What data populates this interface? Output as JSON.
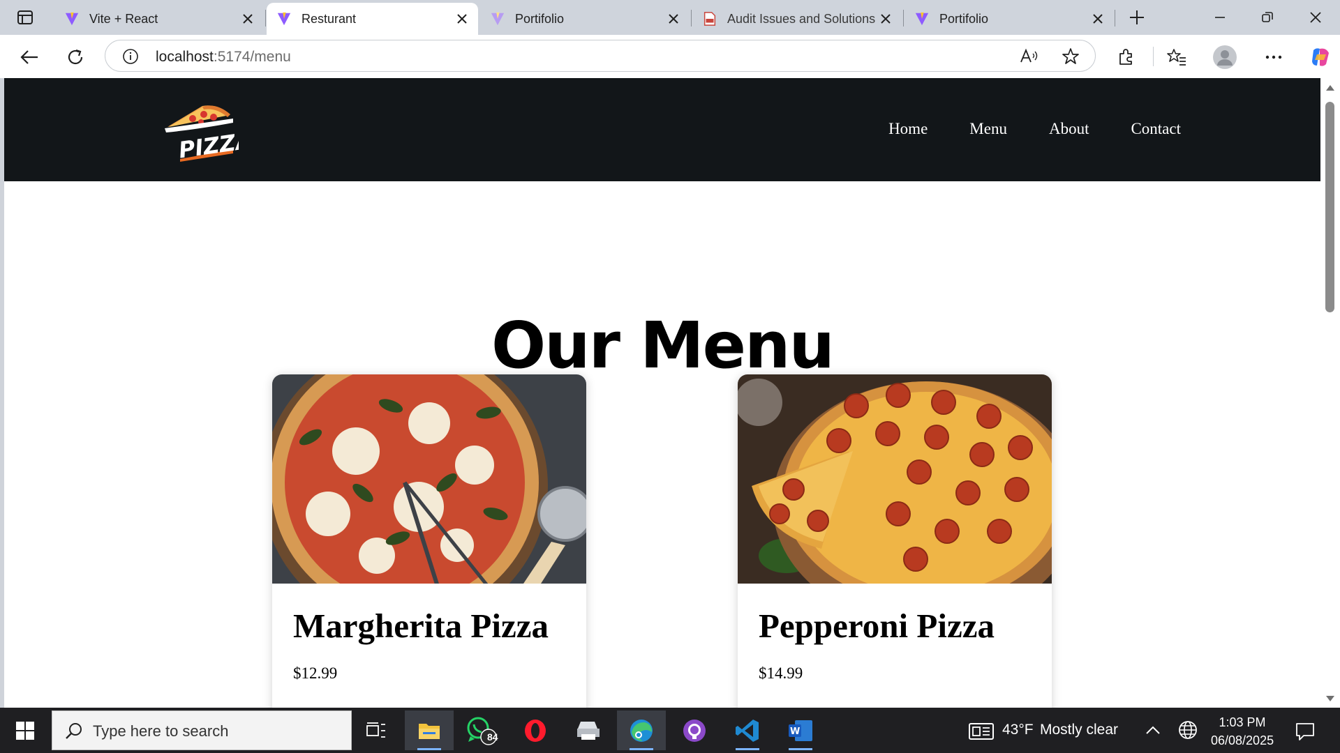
{
  "browser": {
    "tabs": [
      {
        "title": "Vite + React",
        "active": false
      },
      {
        "title": "Resturant",
        "active": true
      },
      {
        "title": "Portifolio",
        "active": false
      },
      {
        "title": "Audit Issues and Solutions",
        "active": false
      },
      {
        "title": "Portifolio",
        "active": false
      }
    ],
    "address": {
      "host": "localhost",
      "path": ":5174/menu"
    }
  },
  "site": {
    "logo_text": "PIZZA",
    "nav": [
      "Home",
      "Menu",
      "About",
      "Contact"
    ],
    "title": "Our Menu",
    "items": [
      {
        "name": "Margherita Pizza",
        "price": "$12.99"
      },
      {
        "name": "Pepperoni Pizza",
        "price": "$14.99"
      }
    ]
  },
  "taskbar": {
    "search_placeholder": "Type here to search",
    "whatsapp_badge": "84",
    "weather": {
      "temp": "43°F",
      "condition": "Mostly clear"
    },
    "time": "1:03 PM",
    "date": "06/08/2025"
  },
  "colors": {
    "header_bg": "#121619",
    "vite_purple": "#8e5bff",
    "vite_yellow": "#ffc629"
  }
}
